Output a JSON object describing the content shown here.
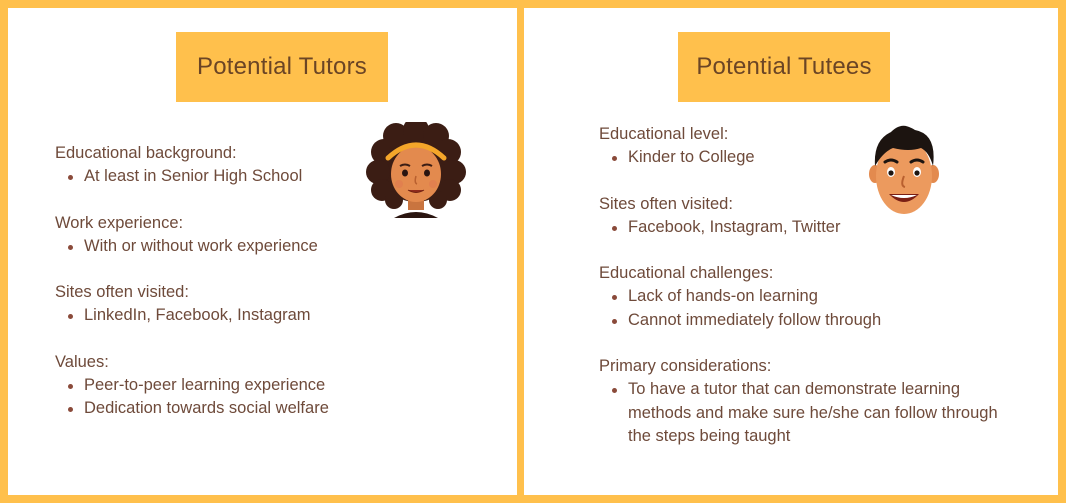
{
  "tutors": {
    "title": "Potential Tutors",
    "sections": [
      {
        "title": "Educational background:",
        "items": [
          "At least in Senior High School"
        ]
      },
      {
        "title": "Work experience:",
        "items": [
          "With or without work experience"
        ]
      },
      {
        "title": "Sites often visited:",
        "items": [
          "LinkedIn, Facebook, Instagram"
        ]
      },
      {
        "title": "Values:",
        "items": [
          "Peer-to-peer learning experience",
          "Dedication towards social welfare"
        ]
      }
    ]
  },
  "tutees": {
    "title": "Potential Tutees",
    "sections": [
      {
        "title": "Educational level:",
        "items": [
          "Kinder to College"
        ]
      },
      {
        "title": "Sites often visited:",
        "items": [
          "Facebook, Instagram, Twitter"
        ]
      },
      {
        "title": "Educational challenges:",
        "items": [
          "Lack of hands-on learning",
          "Cannot immediately follow through"
        ]
      },
      {
        "title": "Primary considerations:",
        "items": [
          "To have a tutor that can demonstrate learning methods and make sure he/she can follow through the steps being taught"
        ]
      }
    ]
  },
  "icons": {
    "tutor_avatar": "female-face-icon",
    "tutee_avatar": "male-face-icon"
  },
  "colors": {
    "accent": "#FFC04C",
    "text": "#6E4A3A",
    "heading_text": "#6B4525",
    "bullet": "#8A4A3A"
  }
}
